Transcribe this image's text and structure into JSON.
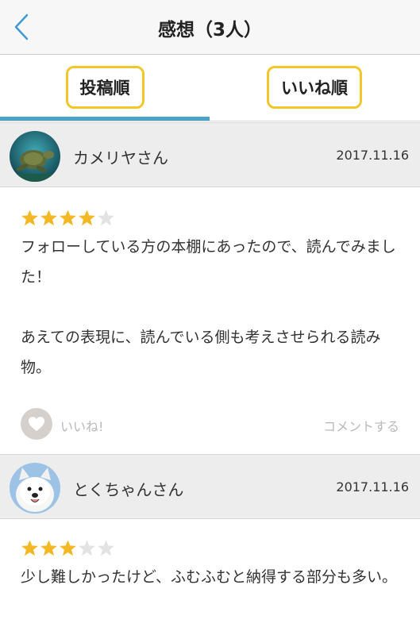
{
  "header": {
    "title": "感想（3人）",
    "back_icon": "chevron-left-icon"
  },
  "tabs": [
    {
      "label": "投稿順",
      "active": true
    },
    {
      "label": "いいね順",
      "active": false
    }
  ],
  "colors": {
    "accent": "#4aa3c9",
    "tab_border": "#f3c72a",
    "star_on": "#f2b825",
    "star_off": "#e3e3e3"
  },
  "reviews": [
    {
      "user": "カメリヤさん",
      "date": "2017.11.16",
      "rating": 4,
      "max_rating": 5,
      "comment": "フォローしている方の本棚にあったので、読んでみました！\n\nあえての表現に、読んでいる側も考えさせられる読み物。",
      "like_label": "いいね!",
      "comment_label": "コメントする"
    },
    {
      "user": "とくちゃんさん",
      "date": "2017.11.16",
      "rating": 3,
      "max_rating": 5,
      "comment": "少し難しかったけど、ふむふむと納得する部分も多い。"
    }
  ]
}
